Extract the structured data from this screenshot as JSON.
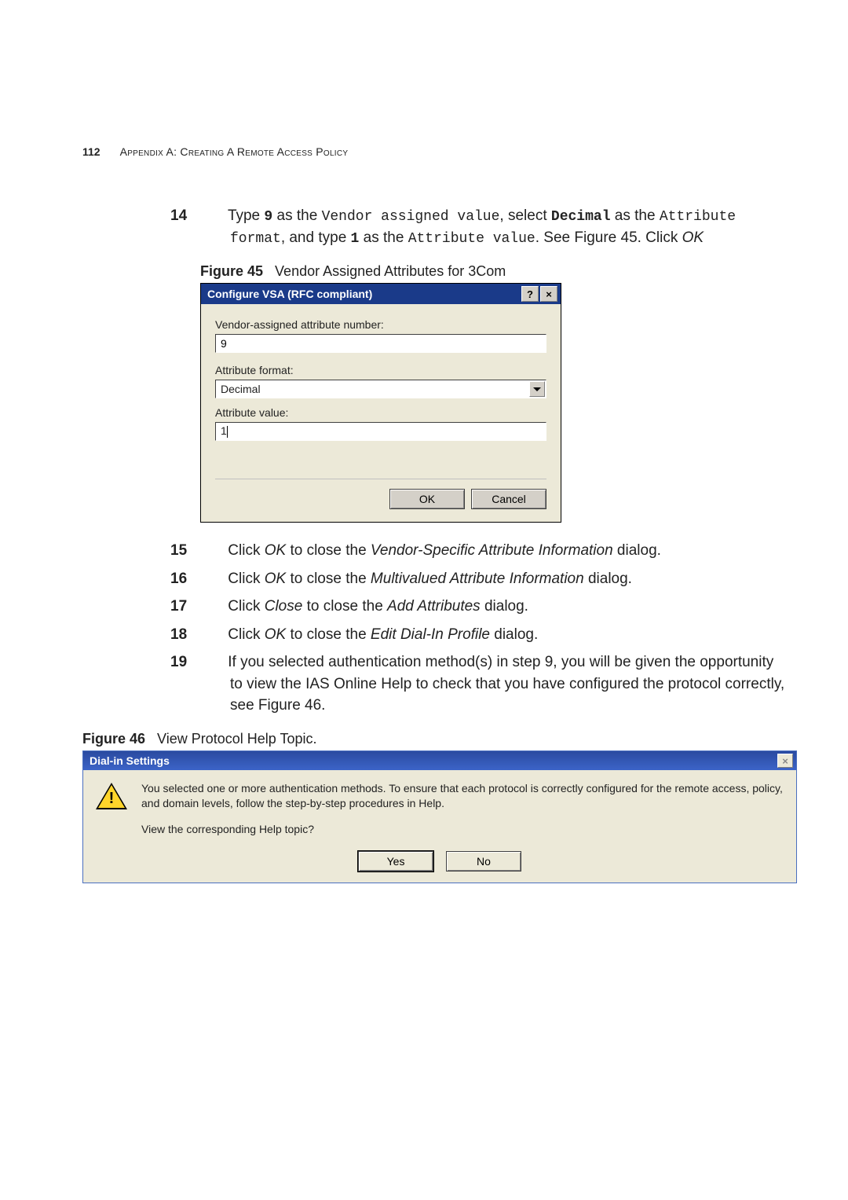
{
  "header": {
    "page_number": "112",
    "appendix_line": "Appendix A: Creating A Remote Access Policy"
  },
  "step14": {
    "num": "14",
    "pre1": "Type ",
    "code1": "9",
    "mid1": " as the ",
    "code2": "Vendor assigned value",
    "mid2": ", select ",
    "code3": "Decimal",
    "mid3": " as the ",
    "code4": "Attribute format",
    "mid4": ", and type ",
    "code5": "1",
    "mid5": " as the ",
    "code6": "Attribute value",
    "tail": ".  See Figure 45. Click ",
    "ok": "OK"
  },
  "fig45": {
    "label": "Figure 45",
    "caption": "Vendor Assigned Attributes for 3Com"
  },
  "vsa": {
    "title": "Configure VSA (RFC compliant)",
    "help_btn": "?",
    "close_btn": "×",
    "label_vendor": "Vendor-assigned attribute number:",
    "value_vendor": "9",
    "label_format": "Attribute format:",
    "value_format": "Decimal",
    "label_value": "Attribute value:",
    "value_value": "1",
    "ok": "OK",
    "cancel": "Cancel"
  },
  "steps": {
    "s15": {
      "num": "15",
      "a": "Click ",
      "i1": "OK",
      "b": " to close the ",
      "i2": "Vendor-Specific Attribute Information",
      "c": " dialog."
    },
    "s16": {
      "num": "16",
      "a": "Click ",
      "i1": "OK",
      "b": " to close the ",
      "i2": "Multivalued Attribute Information",
      "c": " dialog."
    },
    "s17": {
      "num": "17",
      "a": "Click ",
      "i1": "Close",
      "b": " to close the ",
      "i2": "Add Attributes",
      "c": " dialog."
    },
    "s18": {
      "num": "18",
      "a": "Click ",
      "i1": "OK",
      "b": " to close the ",
      "i2": "Edit Dial-In Profile",
      "c": " dialog."
    },
    "s19": {
      "num": "19",
      "text": "If you selected authentication method(s) in step 9, you will be given the opportunity to view the IAS Online Help to check that you have configured the protocol correctly, see Figure 46."
    }
  },
  "fig46": {
    "label": "Figure 46",
    "caption": "View Protocol Help Topic."
  },
  "dial": {
    "title": "Dial-in Settings",
    "close_btn": "×",
    "msg1": "You selected one or more authentication methods. To ensure that each protocol is correctly configured for the remote access, policy, and domain levels, follow the step-by-step procedures in Help.",
    "msg2": "View the corresponding Help topic?",
    "yes": "Yes",
    "no": "No"
  }
}
